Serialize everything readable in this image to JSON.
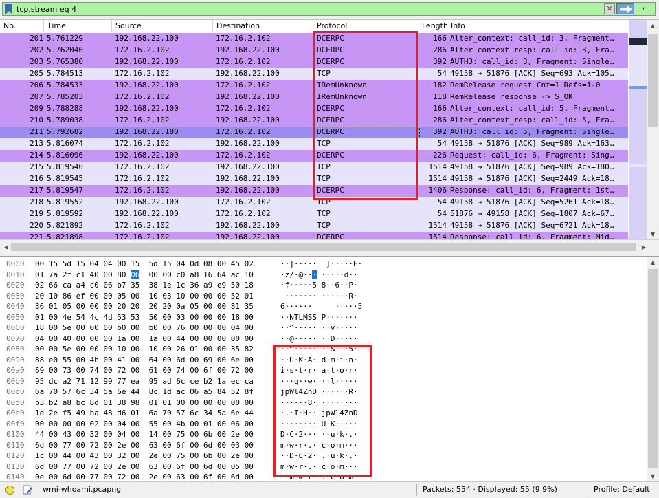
{
  "filter": {
    "value": "tcp.stream eq 4",
    "clear_glyph": "✕",
    "dropdown_glyph": "▾"
  },
  "columns": [
    "No.",
    "Time",
    "Source",
    "Destination",
    "Protocol",
    "Length",
    "Info"
  ],
  "packets": [
    {
      "no": "201",
      "time": "5.761229",
      "src": "192.168.22.100",
      "dst": "172.16.2.102",
      "proto": "DCERPC",
      "len": "166",
      "info": "Alter_context: call_id: 3, Fragment…",
      "kind": "dcerpc"
    },
    {
      "no": "202",
      "time": "5.762040",
      "src": "172.16.2.102",
      "dst": "192.168.22.100",
      "proto": "DCERPC",
      "len": "286",
      "info": "Alter_context_resp: call_id: 3, Fra…",
      "kind": "dcerpc"
    },
    {
      "no": "203",
      "time": "5.765380",
      "src": "192.168.22.100",
      "dst": "172.16.2.102",
      "proto": "DCERPC",
      "len": "392",
      "info": "AUTH3: call_id: 3, Fragment: Single…",
      "kind": "dcerpc"
    },
    {
      "no": "205",
      "time": "5.784513",
      "src": "172.16.2.102",
      "dst": "192.168.22.100",
      "proto": "TCP",
      "len": "54",
      "info": "49158 → 51876 [ACK] Seq=693 Ack=105…",
      "kind": "tcp"
    },
    {
      "no": "206",
      "time": "5.784533",
      "src": "192.168.22.100",
      "dst": "172.16.2.102",
      "proto": "IRemUnknown",
      "len": "182",
      "info": "RemRelease request Cnt=1 Refs=1-0",
      "kind": "irem"
    },
    {
      "no": "207",
      "time": "5.785203",
      "src": "172.16.2.102",
      "dst": "192.168.22.100",
      "proto": "IRemUnknown",
      "len": "118",
      "info": "RemRelease response -> S_OK",
      "kind": "irem"
    },
    {
      "no": "209",
      "time": "5.788288",
      "src": "192.168.22.100",
      "dst": "172.16.2.102",
      "proto": "DCERPC",
      "len": "166",
      "info": "Alter_context: call_id: 5, Fragment…",
      "kind": "dcerpc"
    },
    {
      "no": "210",
      "time": "5.789038",
      "src": "172.16.2.102",
      "dst": "192.168.22.100",
      "proto": "DCERPC",
      "len": "286",
      "info": "Alter_context_resp: call_id: 5, Fra…",
      "kind": "dcerpc"
    },
    {
      "no": "211",
      "time": "5.792682",
      "src": "192.168.22.100",
      "dst": "172.16.2.102",
      "proto": "DCERPC",
      "len": "392",
      "info": "AUTH3: call_id: 5, Fragment: Single…",
      "kind": "sel"
    },
    {
      "no": "213",
      "time": "5.816074",
      "src": "172.16.2.102",
      "dst": "192.168.22.100",
      "proto": "TCP",
      "len": "54",
      "info": "49158 → 51876 [ACK] Seq=989 Ack=163…",
      "kind": "tcp"
    },
    {
      "no": "214",
      "time": "5.816096",
      "src": "192.168.22.100",
      "dst": "172.16.2.102",
      "proto": "DCERPC",
      "len": "226",
      "info": "Request: call_id: 6, Fragment: Sing…",
      "kind": "dcerpc"
    },
    {
      "no": "215",
      "time": "5.819540",
      "src": "172.16.2.102",
      "dst": "192.168.22.100",
      "proto": "TCP",
      "len": "1514",
      "info": "49158 → 51876 [ACK] Seq=989 Ack=180…",
      "kind": "tcp"
    },
    {
      "no": "216",
      "time": "5.819545",
      "src": "172.16.2.102",
      "dst": "192.168.22.100",
      "proto": "TCP",
      "len": "1514",
      "info": "49158 → 51876 [ACK] Seq=2449 Ack=18…",
      "kind": "tcp"
    },
    {
      "no": "217",
      "time": "5.819547",
      "src": "172.16.2.102",
      "dst": "192.168.22.100",
      "proto": "DCERPC",
      "len": "1406",
      "info": "Response: call_id: 6, Fragment: 1st…",
      "kind": "dcerpc"
    },
    {
      "no": "218",
      "time": "5.819552",
      "src": "192.168.22.100",
      "dst": "172.16.2.102",
      "proto": "TCP",
      "len": "54",
      "info": "49158 → 51876 [ACK] Seq=5261 Ack=18…",
      "kind": "tcp"
    },
    {
      "no": "219",
      "time": "5.819592",
      "src": "192.168.22.100",
      "dst": "172.16.2.102",
      "proto": "TCP",
      "len": "54",
      "info": "51876 → 49158 [ACK] Seq=1807 Ack=67…",
      "kind": "tcp"
    },
    {
      "no": "220",
      "time": "5.821892",
      "src": "172.16.2.102",
      "dst": "192.168.22.100",
      "proto": "TCP",
      "len": "1514",
      "info": "49158 → 51876 [ACK] Seq=6721 Ack=18…",
      "kind": "tcp"
    },
    {
      "no": "221",
      "time": "5.821898",
      "src": "172.16.2.102",
      "dst": "192.168.22.100",
      "proto": "DCERPC",
      "len": "1514",
      "info": "Response: call_id: 6, Fragment: Mid…",
      "kind": "dcerpc"
    }
  ],
  "bytes": [
    {
      "off": "0000",
      "hex": "00 15 5d 15 04 04 00 15  5d 15 04 0d 08 00 45 02",
      "asc": "··]·····  ]·····E·"
    },
    {
      "off": "0010",
      "hex": "01 7a 2f c1 40 00 80 ",
      "hexhl": "06",
      "hex2": "  00 00 c0 a8 16 64 ac 10",
      "asc": "·z/·@··",
      "aschl": "·",
      "asc2": " ·····d··"
    },
    {
      "off": "0020",
      "hex": "02 66 ca a4 c0 06 b7 35  38 1e 1c 36 a9 e9 50 18",
      "asc": "·f·····5 8··6··P·"
    },
    {
      "off": "0030",
      "hex": "20 10 86 ef 00 00 05 00  10 03 10 00 00 00 52 01",
      "asc": " ······· ······R·"
    },
    {
      "off": "0040",
      "hex": "36 01 05 00 00 00 20 20  20 20 0a 05 00 00 81 35",
      "asc": "6······     ·····5"
    },
    {
      "off": "0050",
      "hex": "01 00 4e 54 4c 4d 53 53  50 00 03 00 00 00 18 00",
      "asc": "··NTLMSS P·······"
    },
    {
      "off": "0060",
      "hex": "18 00 5e 00 00 00 b0 00  b0 00 76 00 00 00 04 00",
      "asc": "··^····· ··v·····"
    },
    {
      "off": "0070",
      "hex": "04 00 40 00 00 00 1a 00  1a 00 44 00 00 00 00 00",
      "asc": "··@····· ··D·····"
    },
    {
      "off": "0080",
      "hex": "00 00 5e 00 00 00 10 00  10 00 26 01 00 00 35 82",
      "asc": "··^····· ··&···5·"
    },
    {
      "off": "0090",
      "hex": "88 e0 55 00 4b 00 41 00  64 00 6d 00 69 00 6e 00",
      "asc": "··U·K·A· d·m·i·n·"
    },
    {
      "off": "00a0",
      "hex": "69 00 73 00 74 00 72 00  61 00 74 00 6f 00 72 00",
      "asc": "i·s·t·r· a·t·o·r·"
    },
    {
      "off": "00b0",
      "hex": "95 dc a2 71 12 99 77 ea  95 ad 6c ce b2 1a ec ca",
      "asc": "···q··w· ··l·····"
    },
    {
      "off": "00c0",
      "hex": "6a 70 57 6c 34 5a 6e 44  8c 1d ac 06 a5 84 52 8f",
      "asc": "jpWl4ZnD ······R·"
    },
    {
      "off": "00d0",
      "hex": "b3 b2 a8 bc 8d 01 38 98  01 01 00 00 00 00 00 00",
      "asc": "······8· ········"
    },
    {
      "off": "00e0",
      "hex": "1d 2e f5 49 ba 48 d6 01  6a 70 57 6c 34 5a 6e 44",
      "asc": "·.·I·H·· jpWl4ZnD"
    },
    {
      "off": "00f0",
      "hex": "00 00 00 00 02 00 04 00  55 00 4b 00 01 00 06 00",
      "asc": "········ U·K·····"
    },
    {
      "off": "0100",
      "hex": "44 00 43 00 32 00 04 00  14 00 75 00 6b 00 2e 00",
      "asc": "D·C·2··· ··u·k·.·"
    },
    {
      "off": "0110",
      "hex": "6d 00 77 00 72 00 2e 00  63 00 6f 00 6d 00 03 00",
      "asc": "m·w·r·.· c·o·m···"
    },
    {
      "off": "0120",
      "hex": "1c 00 44 00 43 00 32 00  2e 00 75 00 6b 00 2e 00",
      "asc": "··D·C·2· .·u·k·.·"
    },
    {
      "off": "0130",
      "hex": "6d 00 77 00 72 00 2e 00  63 00 6f 00 6d 00 05 00",
      "asc": "m·w·r·.· c·o·m···"
    },
    {
      "off": "0140",
      "hex": "0e 00 6d 00 77 00 72 00  2e 00 63 00 6f 00 6d 00",
      "asc": "··m·w·r· .·c·o·m·"
    }
  ],
  "status": {
    "file": "wmi-whoami.pcapng",
    "packets": "Packets: 554 · Displayed: 55 (9.9%)",
    "profile": "Profile: Default"
  },
  "colors": {
    "filter_bg": "#aff2a4",
    "dcerpc_row": "#c796f5",
    "tcp_row": "#e6e4fb",
    "selected_row": "#9c8cf0",
    "annotation": "#e0202a"
  }
}
